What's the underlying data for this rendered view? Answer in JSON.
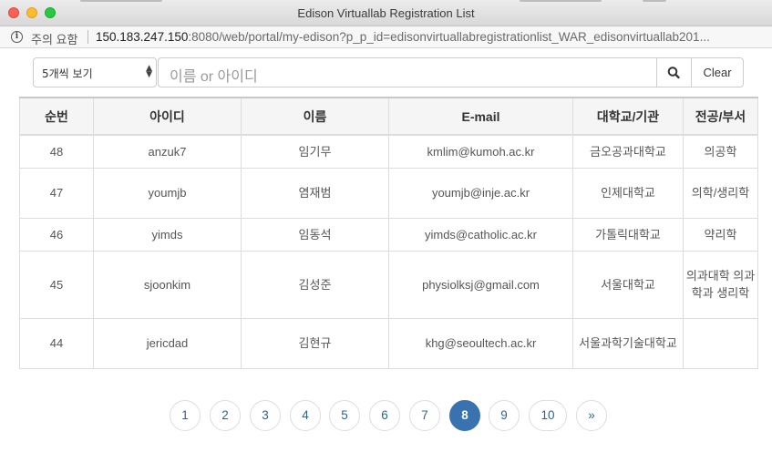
{
  "window": {
    "title": "Edison Virtuallab Registration List"
  },
  "address_bar": {
    "security_label": "주의 요함",
    "url_host": "150.183.247.150",
    "url_rest": ":8080/web/portal/my-edison?p_p_id=edisonvirtuallabregistrationlist_WAR_edisonvirtuallab201..."
  },
  "search": {
    "page_size_selected": "5개씩 보기",
    "placeholder": "이름 or 아이디",
    "clear_label": "Clear"
  },
  "table": {
    "headers": [
      "순번",
      "아이디",
      "이름",
      "E-mail",
      "대학교/기관",
      "전공/부서"
    ],
    "rows": [
      {
        "num": "48",
        "id": "anzuk7",
        "name": "임기무",
        "email": "kmlim@kumoh.ac.kr",
        "org": "금오공과대학교",
        "dept": "의공학"
      },
      {
        "num": "47",
        "id": "youmjb",
        "name": "염재범",
        "email": "youmjb@inje.ac.kr",
        "org": "인제대학교",
        "dept": "의학/생리학"
      },
      {
        "num": "46",
        "id": "yimds",
        "name": "임동석",
        "email": "yimds@catholic.ac.kr",
        "org": "가톨릭대학교",
        "dept": "약리학"
      },
      {
        "num": "45",
        "id": "sjoonkim",
        "name": "김성준",
        "email": "physiolksj@gmail.com",
        "org": "서울대학교",
        "dept": "의과대학 의과학과 생리학"
      },
      {
        "num": "44",
        "id": "jericdad",
        "name": "김현규",
        "email": "khg@seoultech.ac.kr",
        "org": "서울과학기술대학교",
        "dept": ""
      }
    ]
  },
  "pagination": {
    "pages": [
      "1",
      "2",
      "3",
      "4",
      "5",
      "6",
      "7",
      "8",
      "9",
      "10"
    ],
    "current": "8",
    "next_label": "»",
    "active_color": "#3a72b0"
  }
}
